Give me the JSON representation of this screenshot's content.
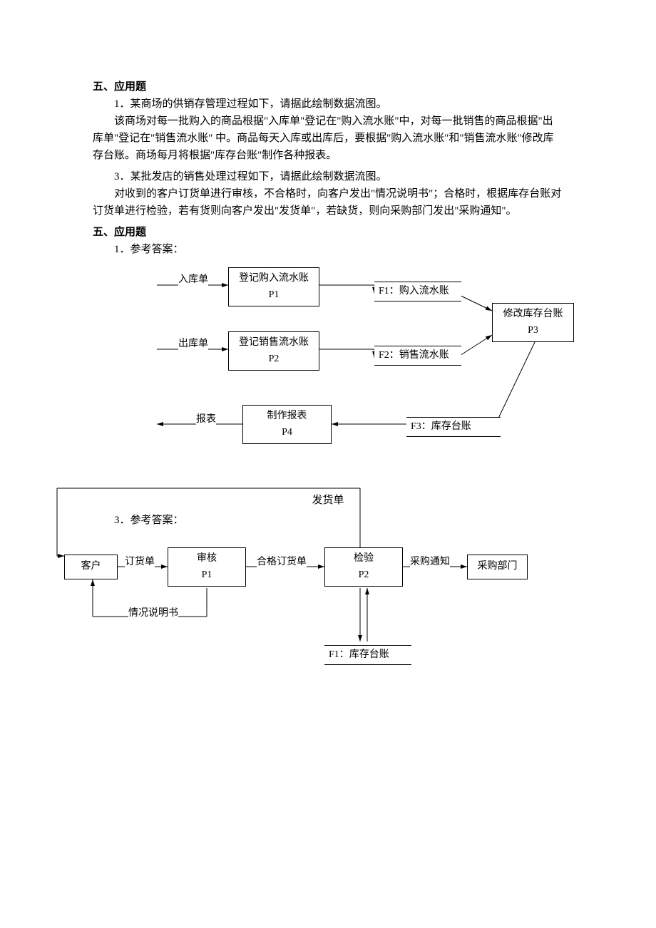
{
  "heading1": "五、应用题",
  "q1_num": "1．某商场的供销存管理过程如下，请据此绘制数据流图。",
  "q1_p1": "该商场对每一批购入的商品根据\"入库单\"登记在\"购入流水账\"中，对每一批销售的商品根据\"出库单\"登记在\"销售流水账\" 中。商品每天入库或出库后，要根据\"购入流水账\"和\"销售流水账\"修改库存台账。商场每月将根据\"库存台账\"制作各种报表。",
  "q3_num": "3．某批发店的销售处理过程如下，请据此绘制数据流图。",
  "q3_p1": "对收到的客户订货单进行审核，不合格时，向客户发出\"情况说明书\"；合格时，根据库存台账对订货单进行检验，若有货则向客户发出\"发货单\"，若缺货，则向采购部门发出\"采购通知\"。",
  "heading2": "五、应用题",
  "ans1": "1．参考答案：",
  "ans3": "3．参考答案：",
  "d1": {
    "p1": "登记购入流水账",
    "p1id": "P1",
    "p2": "登记销售流水账",
    "p2id": "P2",
    "p3": "修改库存台账",
    "p3id": "P3",
    "p4": "制作报表",
    "p4id": "P4",
    "in1": "入库单",
    "in2": "出库单",
    "out": "报表",
    "f1": "F1：购入流水账",
    "f2": "F2：销售流水账",
    "f3": "F3：库存台账"
  },
  "d2": {
    "e1": "客户",
    "p1": "审核",
    "p1id": "P1",
    "p2": "检验",
    "p2id": "P2",
    "e2": "采购部门",
    "l_order": "订货单",
    "l_ok": "合格订货单",
    "l_buy": "采购通知",
    "l_ship": "发货单",
    "l_desc": "情况说明书",
    "f1": "F1：库存台账"
  }
}
